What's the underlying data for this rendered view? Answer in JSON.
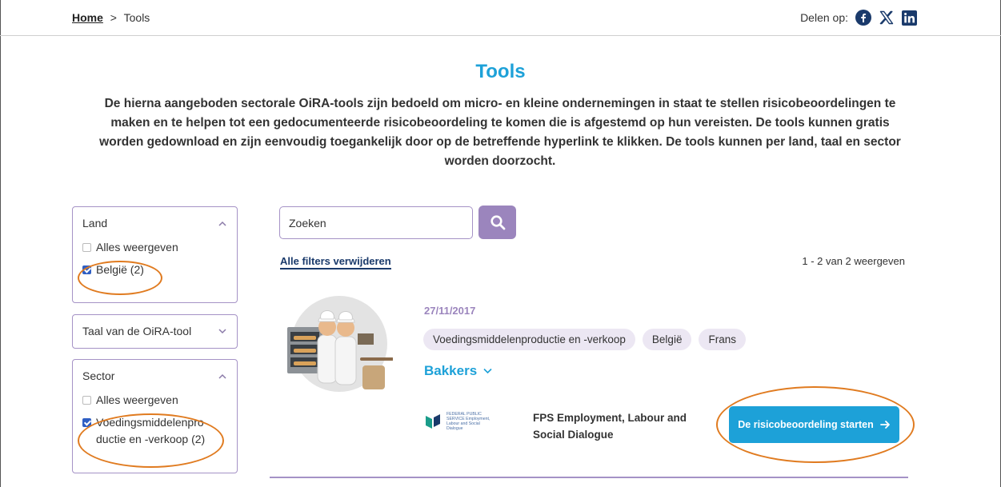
{
  "breadcrumb": {
    "home": "Home",
    "separator": ">",
    "current": "Tools"
  },
  "share": {
    "label": "Delen op:",
    "icons": [
      "facebook-icon",
      "x-icon",
      "linkedin-icon"
    ]
  },
  "page": {
    "title": "Tools",
    "intro": "De hierna aangeboden sectorale OiRA-tools zijn bedoeld om micro- en kleine ondernemingen in staat te stellen risicobeoordelingen te maken en te helpen tot een gedocumenteerde risicobeoordeling te komen die is afgestemd op hun vereisten. De tools kunnen gratis worden gedownload en zijn eenvoudig toegankelijk door op de betreffende hyperlink te klikken. De tools kunnen per land, taal en sector worden doorzocht."
  },
  "filters": {
    "land": {
      "title": "Land",
      "show_all": "Alles weergeven",
      "option": "België (2)"
    },
    "language": {
      "title": "Taal van de OiRA-tool"
    },
    "sector": {
      "title": "Sector",
      "show_all": "Alles weergeven",
      "option": "Voedingsmiddelenpro ductie en -verkoop (2)"
    }
  },
  "search": {
    "placeholder": "Zoeken"
  },
  "results": {
    "clear_filters": "Alle filters verwijderen",
    "count": "1 - 2 van 2 weergeven"
  },
  "tool": {
    "date": "27/11/2017",
    "tags": [
      "Voedingsmiddelenproductie en -verkoop",
      "België",
      "Frans"
    ],
    "name": "Bakkers",
    "org_logo_text": "FEDERAL PUBLIC SERVICE Employment, Labour and Social Dialogue",
    "org_name": "FPS Employment, Labour and Social Dialogue",
    "start_label": "De risicobeoordeling starten"
  },
  "colors": {
    "accent_blue": "#1da1d8",
    "purple": "#9b85bd",
    "highlight_orange": "#e07b20"
  }
}
